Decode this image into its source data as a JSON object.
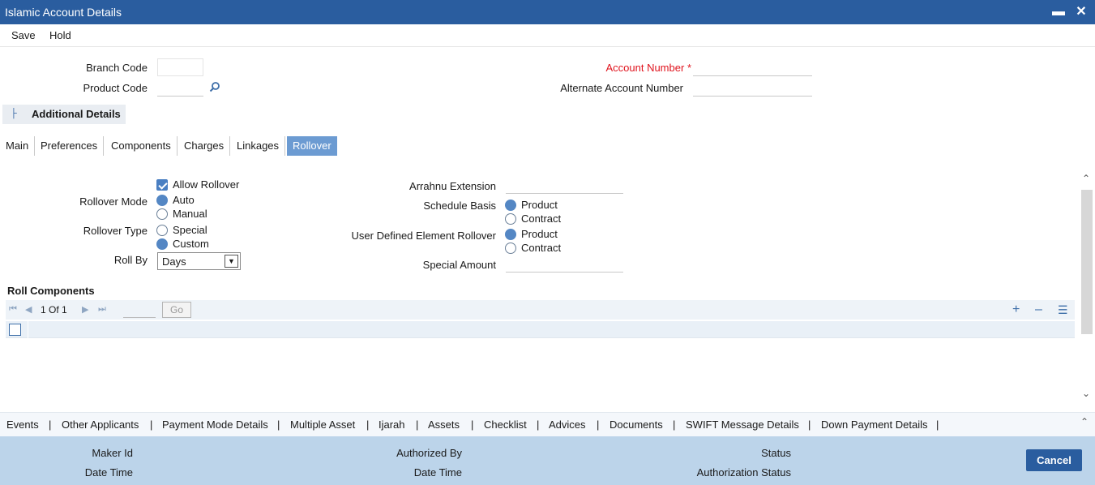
{
  "window": {
    "title": "Islamic Account Details",
    "minimize_icon": "minimize-icon",
    "close_icon": "close-icon"
  },
  "menu": {
    "save": "Save",
    "hold": "Hold"
  },
  "header_fields": {
    "branch_code": {
      "label": "Branch Code",
      "value": ""
    },
    "product_code": {
      "label": "Product Code",
      "value": "",
      "icon": "search-icon"
    },
    "account_number": {
      "label": "Account Number",
      "required_mark": "*",
      "value": ""
    },
    "alternate_account_number": {
      "label": "Alternate Account Number",
      "value": ""
    }
  },
  "additional_details": {
    "label": "Additional Details",
    "toggle_icon": "collapse-icon"
  },
  "tabs": [
    {
      "label": "Main"
    },
    {
      "label": "Preferences"
    },
    {
      "label": "Components"
    },
    {
      "label": "Charges"
    },
    {
      "label": "Linkages"
    },
    {
      "label": "Rollover",
      "active": true
    }
  ],
  "rollover": {
    "allow_rollover": {
      "label": "Allow Rollover",
      "checked": true
    },
    "rollover_mode": {
      "label": "Rollover Mode",
      "options": [
        "Auto",
        "Manual"
      ],
      "selected": "Auto"
    },
    "rollover_type": {
      "label": "Rollover Type",
      "options": [
        "Special",
        "Custom"
      ],
      "selected": "Custom"
    },
    "roll_by": {
      "label": "Roll By",
      "value": "Days"
    },
    "arrahnu_extension": {
      "label": "Arrahnu Extension",
      "value": ""
    },
    "schedule_basis": {
      "label": "Schedule Basis",
      "options": [
        "Product",
        "Contract"
      ],
      "selected": "Product"
    },
    "user_defined_element_rollover": {
      "label": "User Defined Element Rollover",
      "options": [
        "Product",
        "Contract"
      ],
      "selected": "Product"
    },
    "special_amount": {
      "label": "Special Amount",
      "value": ""
    }
  },
  "roll_components": {
    "title": "Roll Components",
    "pagination": {
      "current": "1",
      "of_label": "Of",
      "total": "1",
      "go_label": "Go"
    },
    "actions": [
      "add-icon",
      "remove-icon",
      "single-record-view-icon"
    ]
  },
  "footer_links": [
    "Events",
    "Other Applicants",
    "Payment Mode Details",
    "Multiple Asset",
    "Ijarah",
    "Assets",
    "Checklist",
    "Advices",
    "Documents",
    "SWIFT Message Details",
    "Down Payment Details"
  ],
  "footer_link_separator": "|",
  "audit": {
    "maker_id": "Maker Id",
    "date_time": "Date Time",
    "authorized_by": "Authorized By",
    "date_time_2": "Date Time",
    "status": "Status",
    "authorization_status": "Authorization Status"
  },
  "cancel_button": "Cancel",
  "colors": {
    "title_bar": "#2a5d9f",
    "active_tab": "#6c9bd2",
    "footer": "#bcd4ea",
    "required": "#e0141e"
  }
}
